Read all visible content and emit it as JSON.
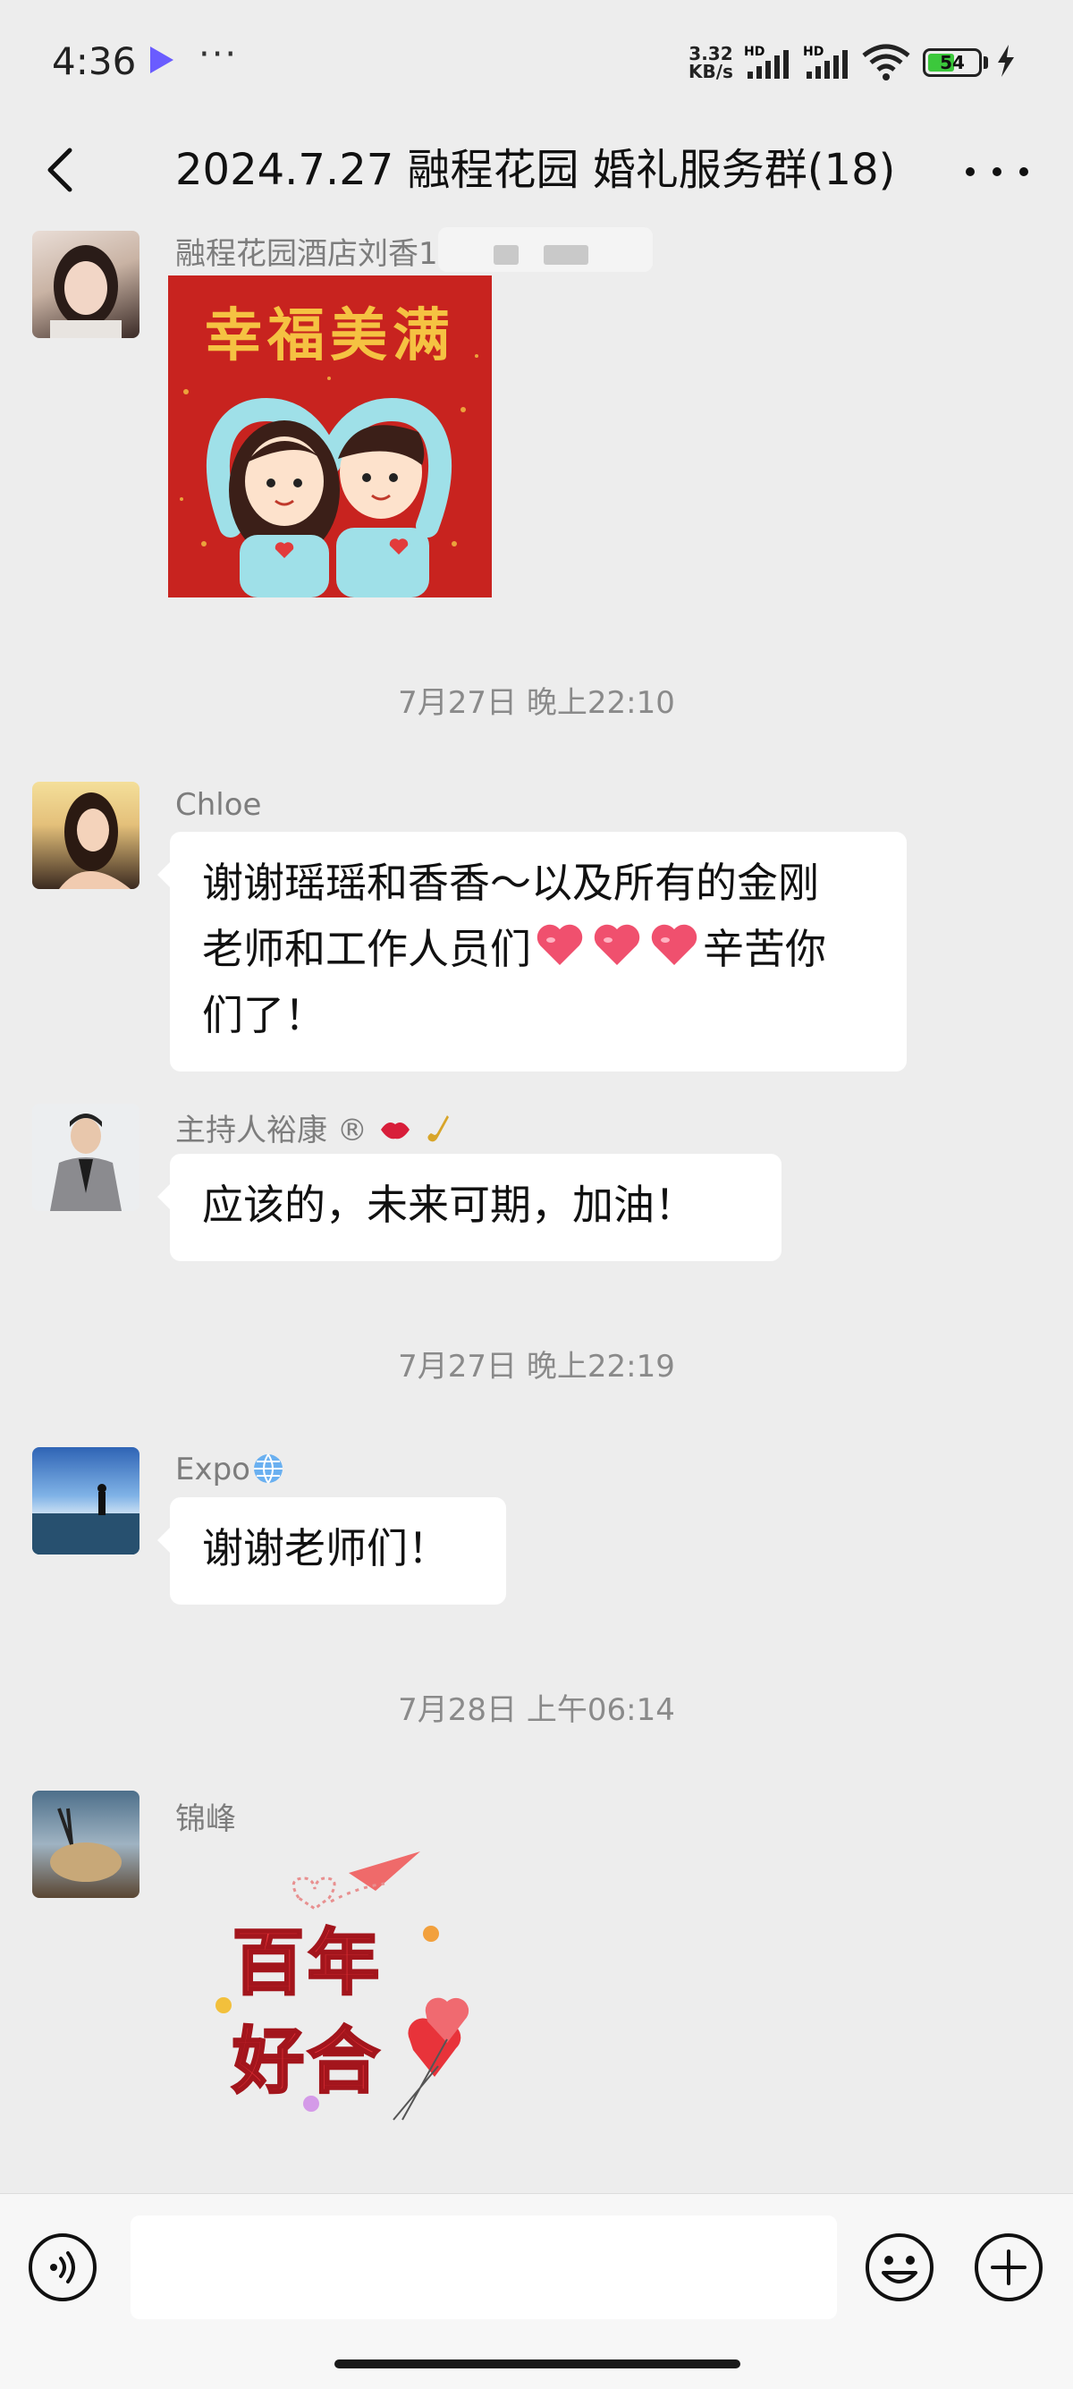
{
  "status_bar": {
    "time": "4:36",
    "more": "···",
    "net_speed_value": "3.32",
    "net_speed_unit": "KB/s",
    "network_type_1": "HD",
    "network_type_2": "HD",
    "battery": "54",
    "battery_level": 0.54
  },
  "header": {
    "title": "2024.7.27 融程花园 婚礼服务群(18)"
  },
  "messages": [
    {
      "sender": "融程花园酒店刘香1",
      "type": "sticker",
      "sticker_text": "幸福美满"
    },
    {
      "timestamp": "7月27日 晚上22:10"
    },
    {
      "sender": "Chloe",
      "text_line1": "谢谢瑶瑶和香香～以及所有的金刚",
      "text_line2a": "老师和工作人员们",
      "text_line2b": "辛苦你",
      "text_line3": "们了！"
    },
    {
      "sender": "主持人裕康",
      "sender_suffix": "®",
      "text": "应该的，未来可期，加油！"
    },
    {
      "timestamp": "7月27日 晚上22:19"
    },
    {
      "sender": "Expo",
      "text": "谢谢老师们！"
    },
    {
      "timestamp": "7月28日 上午06:14"
    },
    {
      "sender": "锦峰",
      "type": "sticker",
      "sticker_line1": "百年",
      "sticker_line2": "好合"
    }
  ],
  "input_bar": {
    "placeholder": ""
  },
  "colors": {
    "background": "#ededed",
    "bubble": "#ffffff",
    "heart": "#f0506e",
    "sticker_red": "#c8231f"
  },
  "icons": [
    "back-arrow-icon",
    "more-icon",
    "voice-icon",
    "emoji-icon",
    "plus-icon",
    "globe-icon",
    "lips-icon",
    "saxophone-icon",
    "heart-icon"
  ]
}
